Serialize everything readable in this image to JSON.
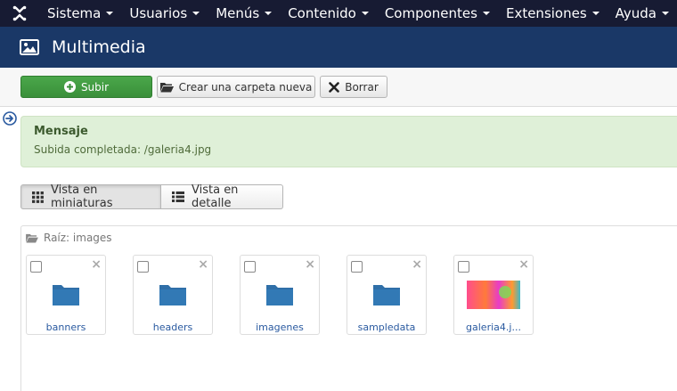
{
  "topnav": {
    "items": [
      {
        "label": "Sistema"
      },
      {
        "label": "Usuarios"
      },
      {
        "label": "Menús"
      },
      {
        "label": "Contenido"
      },
      {
        "label": "Componentes"
      },
      {
        "label": "Extensiones"
      },
      {
        "label": "Ayuda"
      }
    ]
  },
  "header": {
    "title": "Multimedia"
  },
  "toolbar": {
    "upload_label": "Subir",
    "new_folder_label": "Crear una carpeta nueva",
    "delete_label": "Borrar"
  },
  "message": {
    "heading": "Mensaje",
    "text": "Subida completada: /galeria4.jpg"
  },
  "views": {
    "thumbnails_label": "Vista en miniaturas",
    "detail_label": "Vista en detalle"
  },
  "browser": {
    "breadcrumb": "Raíz: images",
    "items": [
      {
        "name": "banners",
        "type": "folder"
      },
      {
        "name": "headers",
        "type": "folder"
      },
      {
        "name": "imagenes",
        "type": "folder"
      },
      {
        "name": "sampledata",
        "type": "folder"
      },
      {
        "name": "galeria4.j...",
        "type": "image"
      }
    ]
  },
  "colors": {
    "topnav": "#171b33",
    "header": "#1a3867",
    "success": "#3a8f3a",
    "folder": "#2f6fa8",
    "message_bg": "#dff0d8"
  }
}
